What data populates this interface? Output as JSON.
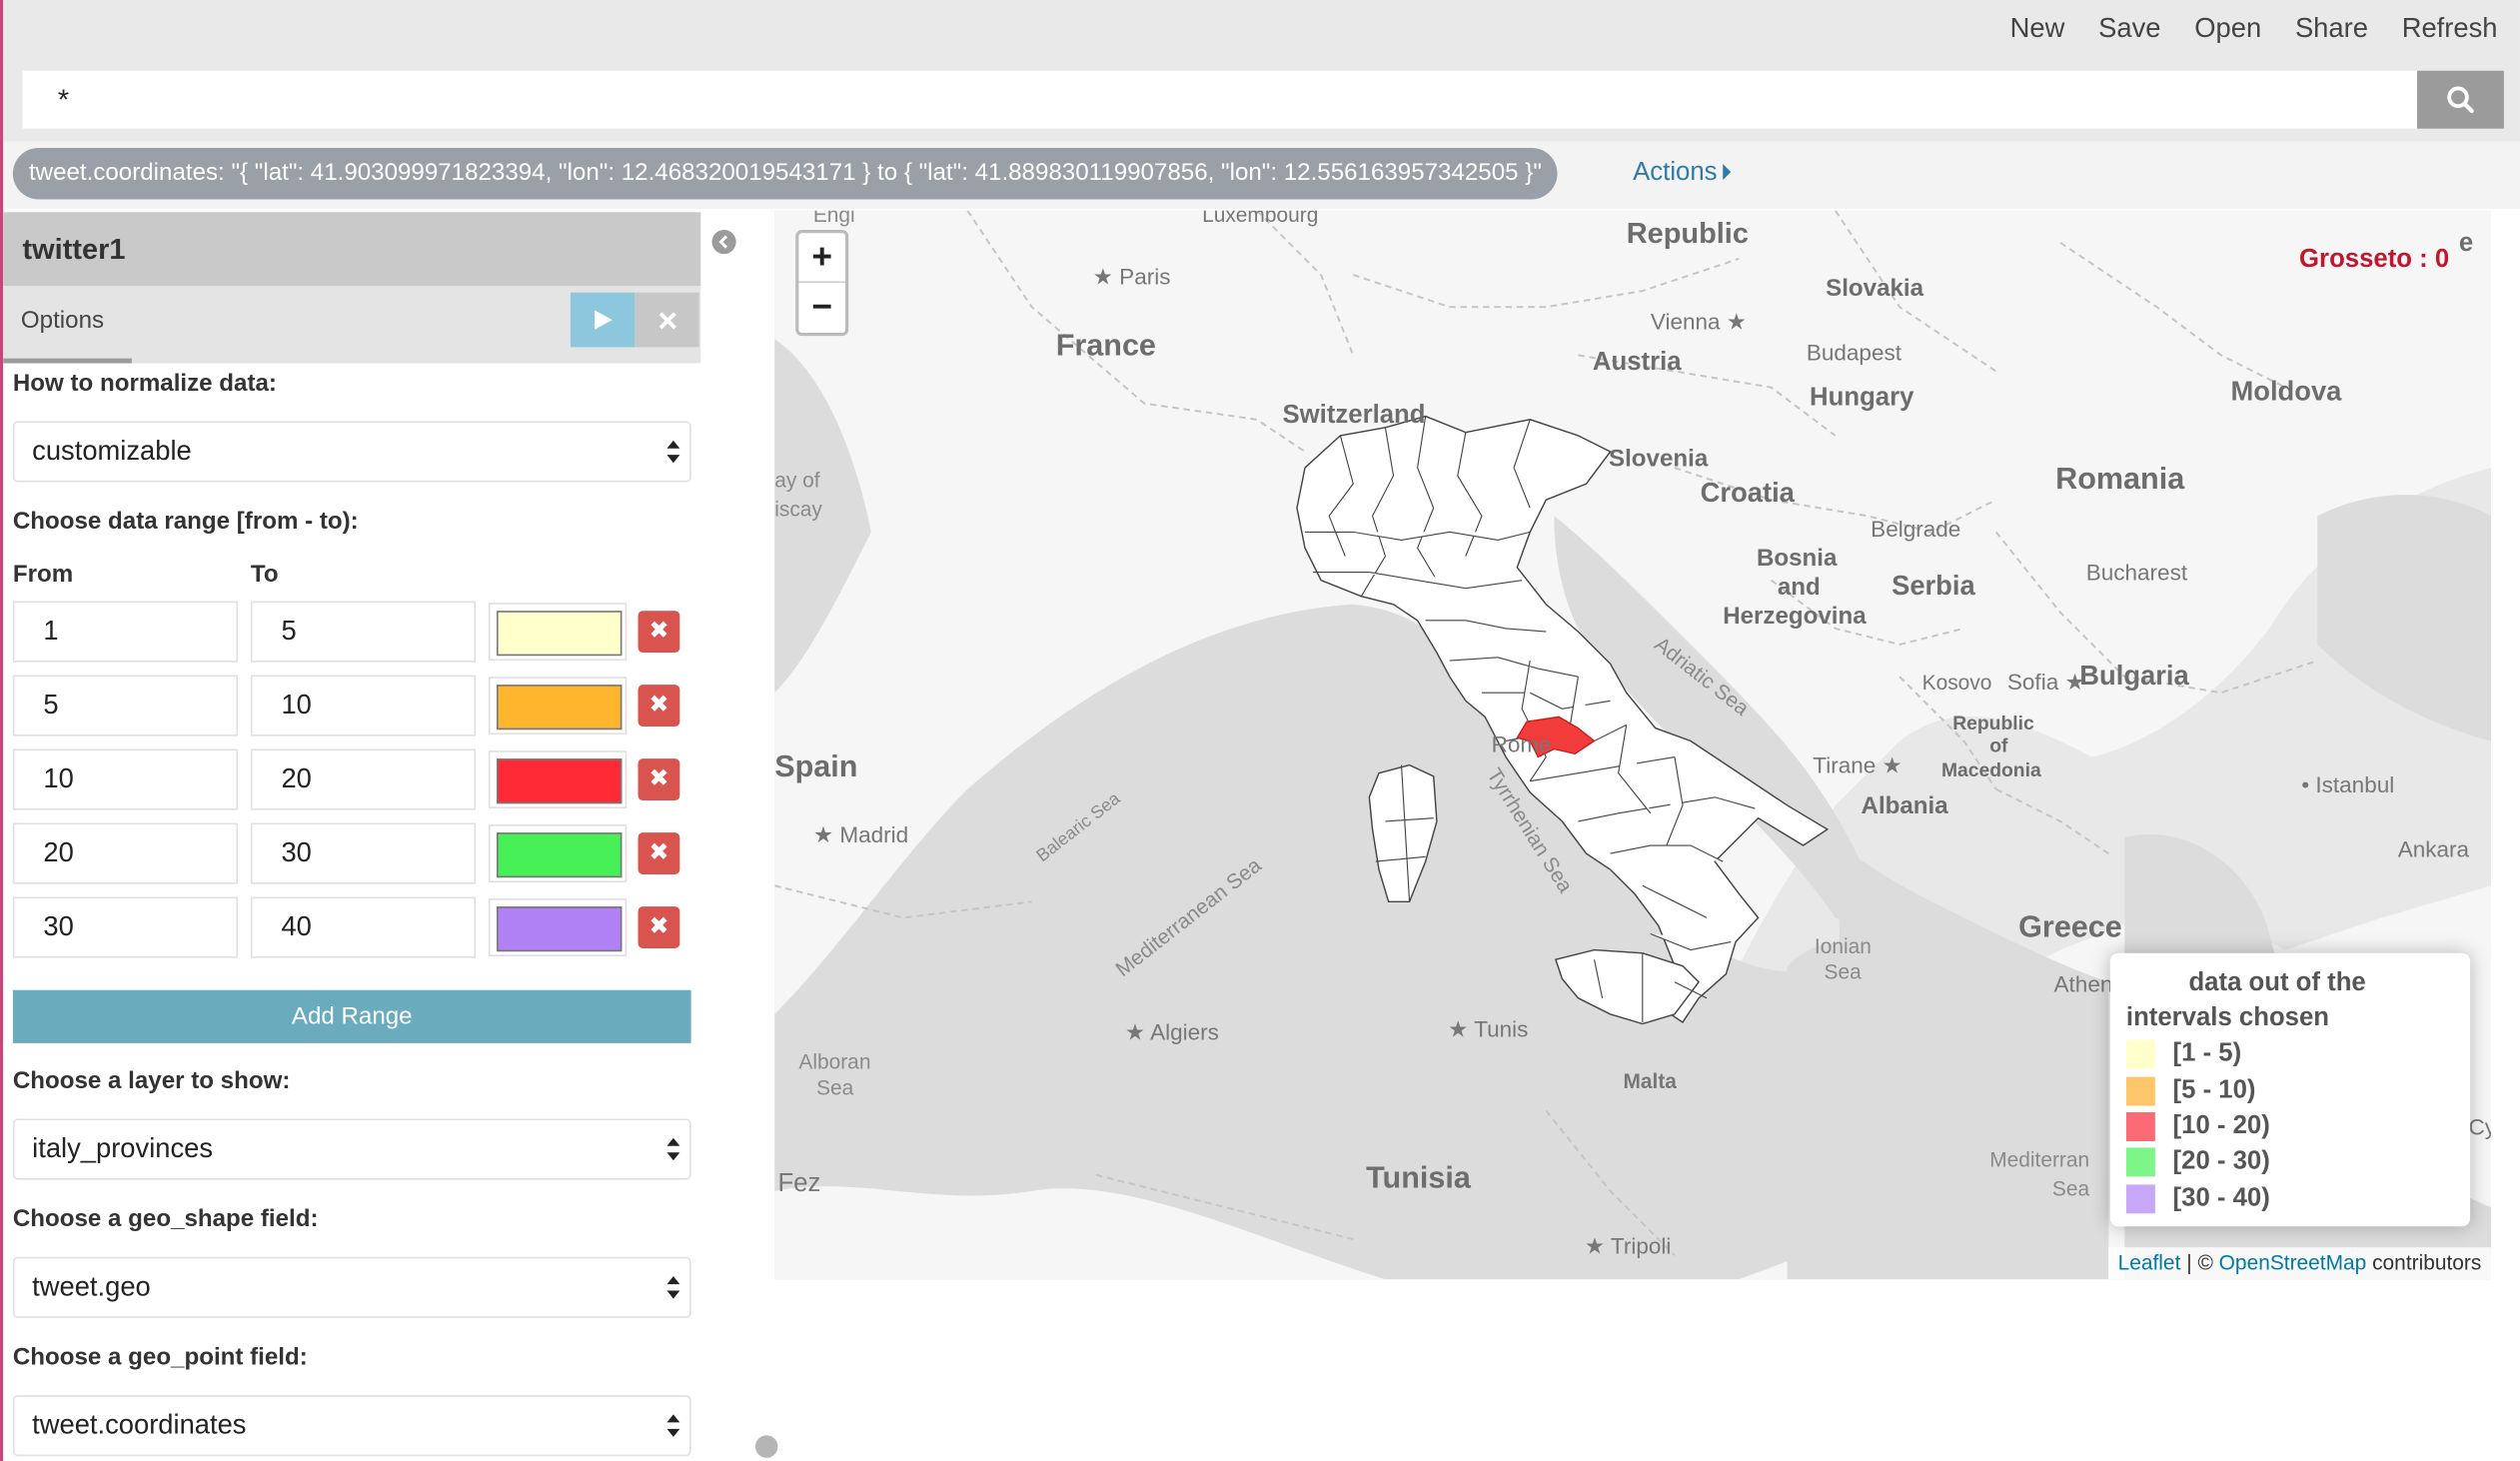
{
  "topmenu": {
    "new": "New",
    "save": "Save",
    "open": "Open",
    "share": "Share",
    "refresh": "Refresh"
  },
  "search": {
    "query": "*",
    "icon": "search-icon"
  },
  "filter": {
    "pill": "tweet.coordinates: \"{ \"lat\": 41.903099971823394, \"lon\": 12.468320019543171 } to { \"lat\": 41.889830119907856, \"lon\": 12.556163957342505 }\"",
    "actions": "Actions"
  },
  "sidebar": {
    "title": "twitter1",
    "tab_options": "Options",
    "normalize_label": "How to normalize data:",
    "normalize_value": "customizable",
    "range_label": "Choose data range [from - to):",
    "from_label": "From",
    "to_label": "To",
    "ranges": [
      {
        "from": "1",
        "to": "5",
        "color": "#ffffcc"
      },
      {
        "from": "5",
        "to": "10",
        "color": "#ffb52e"
      },
      {
        "from": "10",
        "to": "20",
        "color": "#ff2a36"
      },
      {
        "from": "20",
        "to": "30",
        "color": "#48f057"
      },
      {
        "from": "30",
        "to": "40",
        "color": "#b081f5"
      }
    ],
    "add_range": "Add Range",
    "layer_label": "Choose a layer to show:",
    "layer_value": "italy_provinces",
    "geo_shape_label": "Choose a geo_shape field:",
    "geo_shape_value": "tweet.geo",
    "geo_point_label": "Choose a geo_point field:",
    "geo_point_value": "tweet.coordinates"
  },
  "map": {
    "hover_info": "Grosseto : 0",
    "zoom_in": "+",
    "zoom_out": "−",
    "highlight_color": "#f23b3b",
    "labels": {
      "france": "France",
      "switzerland": "Switzerland",
      "austria": "Austria",
      "hungary": "Hungary",
      "slovakia": "Slovakia",
      "republic": "Republic",
      "moldova": "Moldova",
      "romania": "Romania",
      "slovenia": "Slovenia",
      "croatia": "Croatia",
      "bosnia1": "Bosnia",
      "bosnia2": "and",
      "bosnia3": "Herzegovina",
      "serbia": "Serbia",
      "bulgaria": "Bulgaria",
      "albania": "Albania",
      "macedonia1": "Republic",
      "macedonia2": "of",
      "macedonia3": "Macedonia",
      "greece": "Greece",
      "spain": "Spain",
      "tunisia": "Tunisia",
      "paris": "Paris",
      "vienna": "Vienna",
      "budapest": "Budapest",
      "belgrade": "Belgrade",
      "bucharest": "Bucharest",
      "kosovo": "Kosovo",
      "sofia": "Sofia",
      "istanbul": "Istanbul",
      "ankara": "Ankara",
      "tirane": "Tirane",
      "athens": "Athens",
      "rome": "Rome",
      "madrid": "Madrid",
      "algiers": "Algiers",
      "tunis": "Tunis",
      "tripoli": "Tripoli",
      "malta": "Malta",
      "fez": "Fez",
      "luxembourg": "Luxembourg",
      "engl": "Engl",
      "bay1": "ay of",
      "bay2": "iscay",
      "adriatic": "Adriatic Sea",
      "tyrrhenian": "Tyrrhenian Sea",
      "mediterranean": "Mediterranean Sea",
      "balearic": "Balearic Sea",
      "ionian1": "Ionian",
      "ionian2": "Sea",
      "alboran1": "Alboran",
      "alboran2": "Sea",
      "mediterr1": "Mediterran",
      "mediterr2": "Sea",
      "edge_e": "e",
      "edge_cy": "Cy"
    },
    "legend": {
      "title1": "data out of the",
      "title2": "intervals chosen",
      "items": [
        {
          "label": "[1 - 5)",
          "color": "#ffffcc"
        },
        {
          "label": "[5 - 10)",
          "color": "#fdc66b"
        },
        {
          "label": "[10 - 20)",
          "color": "#fa6b75"
        },
        {
          "label": "[20 - 30)",
          "color": "#7df589"
        },
        {
          "label": "[30 - 40)",
          "color": "#c9a7f8"
        }
      ]
    },
    "attribution": {
      "leaflet": "Leaflet",
      "sep": " | © ",
      "osm": "OpenStreetMap",
      "rest": " contributors"
    }
  }
}
